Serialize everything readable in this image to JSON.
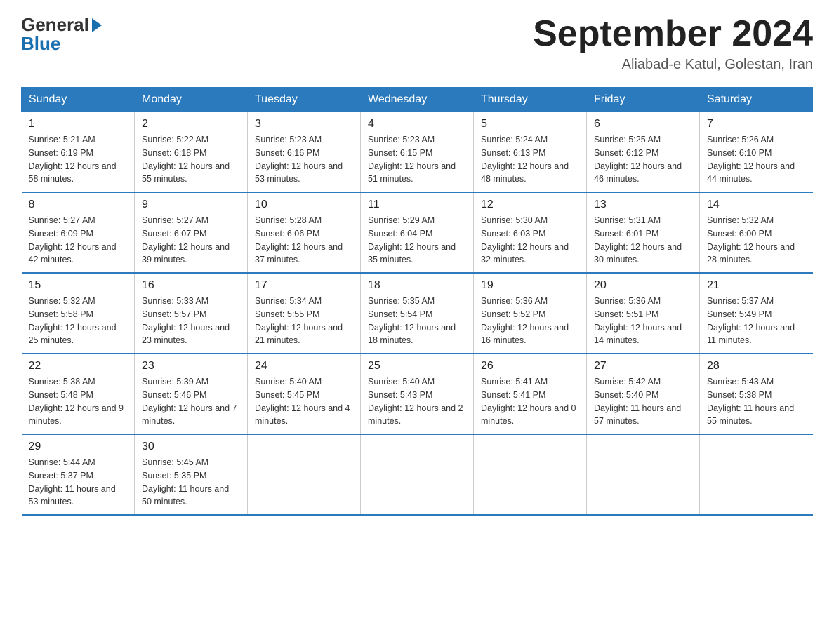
{
  "logo": {
    "general": "General",
    "blue": "Blue"
  },
  "title": "September 2024",
  "subtitle": "Aliabad-e Katul, Golestan, Iran",
  "days_of_week": [
    "Sunday",
    "Monday",
    "Tuesday",
    "Wednesday",
    "Thursday",
    "Friday",
    "Saturday"
  ],
  "weeks": [
    [
      {
        "day": "1",
        "sunrise": "5:21 AM",
        "sunset": "6:19 PM",
        "daylight": "12 hours and 58 minutes."
      },
      {
        "day": "2",
        "sunrise": "5:22 AM",
        "sunset": "6:18 PM",
        "daylight": "12 hours and 55 minutes."
      },
      {
        "day": "3",
        "sunrise": "5:23 AM",
        "sunset": "6:16 PM",
        "daylight": "12 hours and 53 minutes."
      },
      {
        "day": "4",
        "sunrise": "5:23 AM",
        "sunset": "6:15 PM",
        "daylight": "12 hours and 51 minutes."
      },
      {
        "day": "5",
        "sunrise": "5:24 AM",
        "sunset": "6:13 PM",
        "daylight": "12 hours and 48 minutes."
      },
      {
        "day": "6",
        "sunrise": "5:25 AM",
        "sunset": "6:12 PM",
        "daylight": "12 hours and 46 minutes."
      },
      {
        "day": "7",
        "sunrise": "5:26 AM",
        "sunset": "6:10 PM",
        "daylight": "12 hours and 44 minutes."
      }
    ],
    [
      {
        "day": "8",
        "sunrise": "5:27 AM",
        "sunset": "6:09 PM",
        "daylight": "12 hours and 42 minutes."
      },
      {
        "day": "9",
        "sunrise": "5:27 AM",
        "sunset": "6:07 PM",
        "daylight": "12 hours and 39 minutes."
      },
      {
        "day": "10",
        "sunrise": "5:28 AM",
        "sunset": "6:06 PM",
        "daylight": "12 hours and 37 minutes."
      },
      {
        "day": "11",
        "sunrise": "5:29 AM",
        "sunset": "6:04 PM",
        "daylight": "12 hours and 35 minutes."
      },
      {
        "day": "12",
        "sunrise": "5:30 AM",
        "sunset": "6:03 PM",
        "daylight": "12 hours and 32 minutes."
      },
      {
        "day": "13",
        "sunrise": "5:31 AM",
        "sunset": "6:01 PM",
        "daylight": "12 hours and 30 minutes."
      },
      {
        "day": "14",
        "sunrise": "5:32 AM",
        "sunset": "6:00 PM",
        "daylight": "12 hours and 28 minutes."
      }
    ],
    [
      {
        "day": "15",
        "sunrise": "5:32 AM",
        "sunset": "5:58 PM",
        "daylight": "12 hours and 25 minutes."
      },
      {
        "day": "16",
        "sunrise": "5:33 AM",
        "sunset": "5:57 PM",
        "daylight": "12 hours and 23 minutes."
      },
      {
        "day": "17",
        "sunrise": "5:34 AM",
        "sunset": "5:55 PM",
        "daylight": "12 hours and 21 minutes."
      },
      {
        "day": "18",
        "sunrise": "5:35 AM",
        "sunset": "5:54 PM",
        "daylight": "12 hours and 18 minutes."
      },
      {
        "day": "19",
        "sunrise": "5:36 AM",
        "sunset": "5:52 PM",
        "daylight": "12 hours and 16 minutes."
      },
      {
        "day": "20",
        "sunrise": "5:36 AM",
        "sunset": "5:51 PM",
        "daylight": "12 hours and 14 minutes."
      },
      {
        "day": "21",
        "sunrise": "5:37 AM",
        "sunset": "5:49 PM",
        "daylight": "12 hours and 11 minutes."
      }
    ],
    [
      {
        "day": "22",
        "sunrise": "5:38 AM",
        "sunset": "5:48 PM",
        "daylight": "12 hours and 9 minutes."
      },
      {
        "day": "23",
        "sunrise": "5:39 AM",
        "sunset": "5:46 PM",
        "daylight": "12 hours and 7 minutes."
      },
      {
        "day": "24",
        "sunrise": "5:40 AM",
        "sunset": "5:45 PM",
        "daylight": "12 hours and 4 minutes."
      },
      {
        "day": "25",
        "sunrise": "5:40 AM",
        "sunset": "5:43 PM",
        "daylight": "12 hours and 2 minutes."
      },
      {
        "day": "26",
        "sunrise": "5:41 AM",
        "sunset": "5:41 PM",
        "daylight": "12 hours and 0 minutes."
      },
      {
        "day": "27",
        "sunrise": "5:42 AM",
        "sunset": "5:40 PM",
        "daylight": "11 hours and 57 minutes."
      },
      {
        "day": "28",
        "sunrise": "5:43 AM",
        "sunset": "5:38 PM",
        "daylight": "11 hours and 55 minutes."
      }
    ],
    [
      {
        "day": "29",
        "sunrise": "5:44 AM",
        "sunset": "5:37 PM",
        "daylight": "11 hours and 53 minutes."
      },
      {
        "day": "30",
        "sunrise": "5:45 AM",
        "sunset": "5:35 PM",
        "daylight": "11 hours and 50 minutes."
      },
      {
        "day": "",
        "sunrise": "",
        "sunset": "",
        "daylight": ""
      },
      {
        "day": "",
        "sunrise": "",
        "sunset": "",
        "daylight": ""
      },
      {
        "day": "",
        "sunrise": "",
        "sunset": "",
        "daylight": ""
      },
      {
        "day": "",
        "sunrise": "",
        "sunset": "",
        "daylight": ""
      },
      {
        "day": "",
        "sunrise": "",
        "sunset": "",
        "daylight": ""
      }
    ]
  ]
}
